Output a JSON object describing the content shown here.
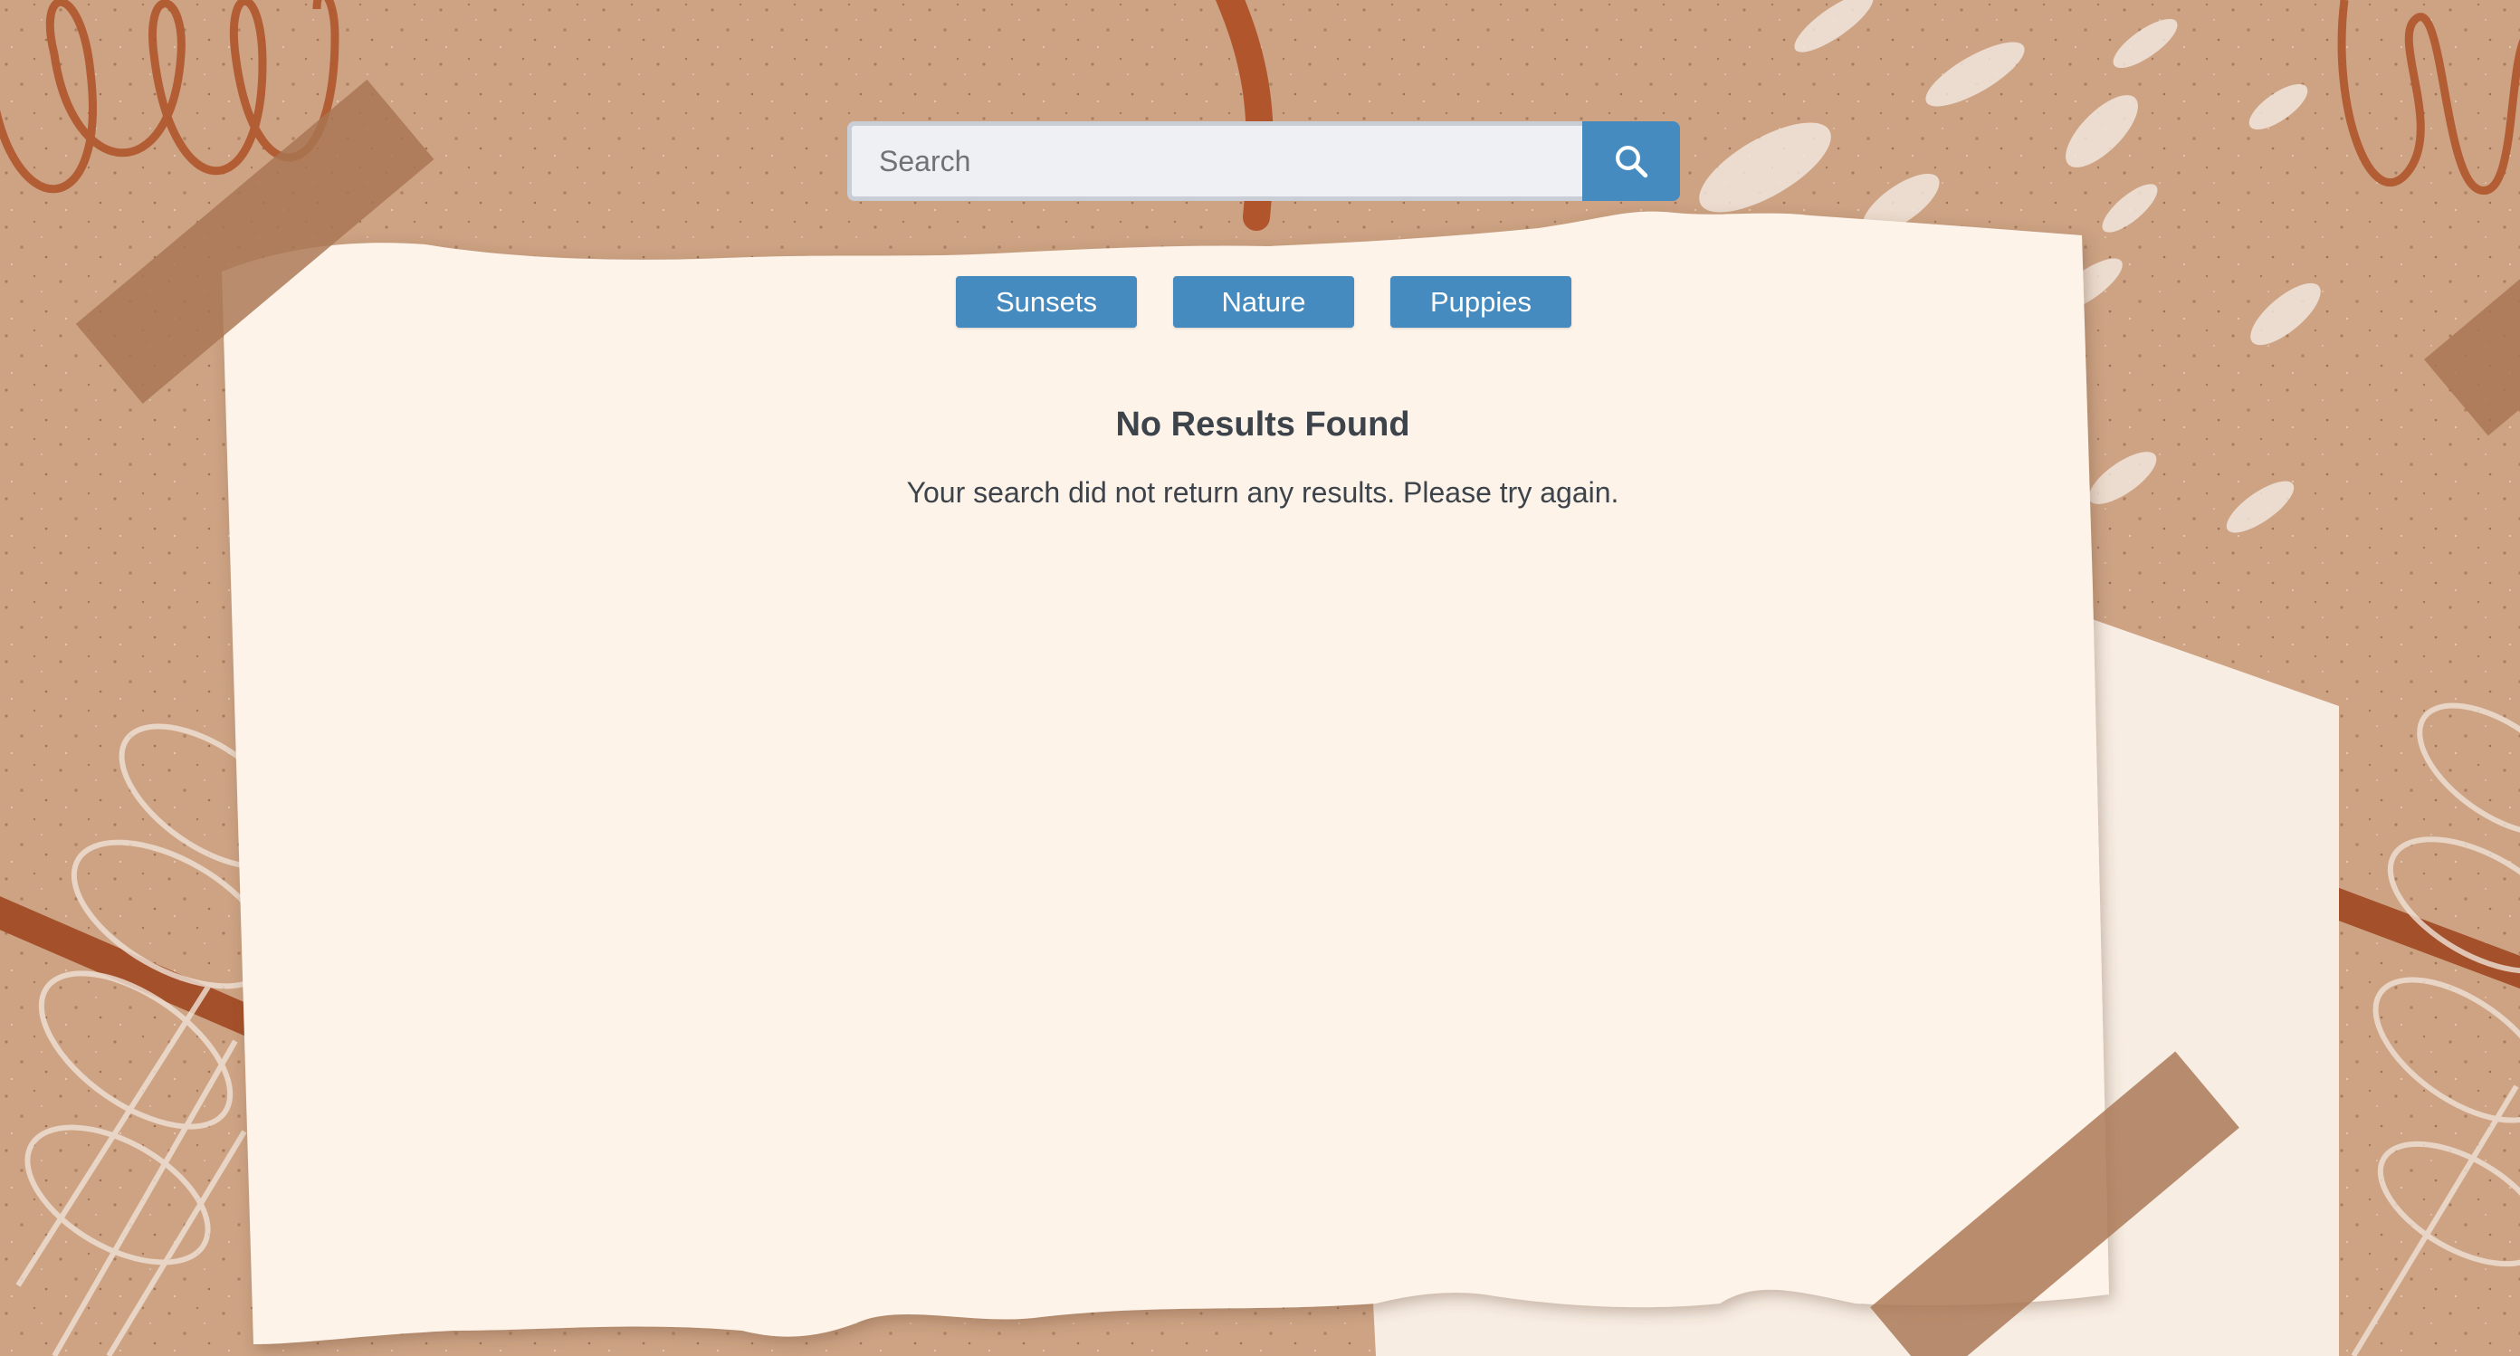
{
  "search": {
    "placeholder": "Search",
    "value": "",
    "button_icon": "search-icon"
  },
  "categories": [
    {
      "label": "Sunsets"
    },
    {
      "label": "Nature"
    },
    {
      "label": "Puppies"
    }
  ],
  "results": {
    "title": "No Results Found",
    "message": "Your search did not return any results. Please try again."
  },
  "colors": {
    "accent": "#468bbf",
    "background": "#cda384",
    "paper": "#fdf3e9",
    "text": "#3d434a",
    "rust": "#b0552c"
  }
}
